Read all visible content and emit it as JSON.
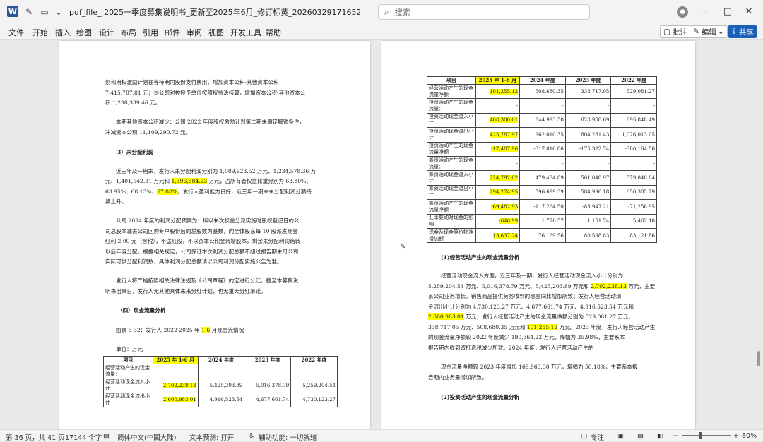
{
  "window": {
    "title": "pdf_file_    2025一季度募集说明书_更新至2025年6月_修订标黄_20260329171652_20260329171653.d...",
    "app_icon_letter": "W",
    "search_placeholder": "搜索",
    "avatar_icon": "user-icon",
    "minimize": "─",
    "maximize": "□",
    "close": "✕"
  },
  "menu": [
    "文件",
    "开始",
    "插入",
    "绘图",
    "设计",
    "布局",
    "引用",
    "邮件",
    "审阅",
    "视图",
    "开发工具",
    "帮助"
  ],
  "ribbon_right": {
    "comment": "批注",
    "edit": "编辑",
    "share": "共享"
  },
  "page1": {
    "lines": [
      {
        "parts": [
          {
            "t": "划和期权激励计划在等待期内股份支付费用，增加资本公积-其他资本公积"
          }
        ]
      },
      {
        "parts": [
          {
            "t": "7,415,787.81 元；③公司对被授予单位按照权益法核算，增加资本公积-其他资本公"
          }
        ]
      },
      {
        "parts": [
          {
            "t": "积 1,298,339.46 元。"
          }
        ]
      },
      {
        "parts": [
          {
            "t": "本期其他资本公积减少：公司 2022 年度股权激励计划第二期未满足解锁条件，"
          }
        ]
      },
      {
        "parts": [
          {
            "t": "冲减资本公积 11,109,290.72 元。"
          }
        ]
      },
      {
        "parts": [
          {
            "t": "3）未分配利润",
            "b": true
          }
        ]
      },
      {
        "parts": [
          {
            "t": "近三年及一期末，发行人未分配利润分别为 1,089,923.52 万元、1,234,578.36 万"
          }
        ]
      },
      {
        "parts": [
          {
            "t": "元、1,401,542.31 万元和 "
          },
          {
            "t": "1,396,584.23",
            "h": true
          },
          {
            "t": " 万元，占所有者权益比重分别为 63.80%、"
          }
        ]
      },
      {
        "parts": [
          {
            "t": "63.95%、68.13%、"
          },
          {
            "t": "67.88%",
            "h": true
          },
          {
            "t": "。发行人盈利能力良好，近三年一期末未分配利润分额持"
          }
        ]
      },
      {
        "parts": [
          {
            "t": "续上升。"
          }
        ]
      },
      {
        "parts": [
          {
            "t": "公司 2024 年度的利润分配预案为：拟以未次权益分派实施时股权登记日的公"
          }
        ]
      },
      {
        "parts": [
          {
            "t": "司总股本减去公司回购专户股份后的总股数为基数，向全体股东每 10 股派发现金"
          }
        ]
      },
      {
        "parts": [
          {
            "t": "红利 2.00 元（含税），不送红股，不以资本公积金转增股本，剩余未分配利润结转"
          }
        ]
      },
      {
        "parts": [
          {
            "t": "以后年度分配。根据相关规定，公司保证本次利润分配总额不超过报告期末母公司"
          }
        ]
      },
      {
        "parts": [
          {
            "t": "实际可供分配利润数，具体利润分配总额请以公司利润分配实施公告为准。"
          }
        ]
      },
      {
        "parts": [
          {
            "t": "发行人将严格按照相关法律法规及《公司章程》的定进行分红，截至本募集说"
          }
        ]
      },
      {
        "parts": [
          {
            "t": "明书出具日，发行人无其他具体未来分红计划，也无重大分红承诺。"
          }
        ]
      },
      {
        "parts": [
          {
            "t": "（四）现金流量分析",
            "b": true
          }
        ]
      },
      {
        "parts": [
          {
            "t": "图表 6-32：发行人 2022-2025 年 "
          },
          {
            "t": "1-6",
            "h": true
          },
          {
            "t": " 月现金流情况"
          }
        ]
      },
      {
        "parts": [
          {
            "t": "单位：万元",
            "u": true
          }
        ]
      }
    ],
    "table": {
      "headers": [
        "项目",
        "2025 年 1-6 月",
        "2024 年度",
        "2023 年度",
        "2022 年度"
      ],
      "rows": [
        {
          "label": "经营活动产生的现金流量：",
          "values": [
            "",
            "",
            "",
            ""
          ]
        },
        {
          "label": "经营活动现金流入小计",
          "values": [
            "2,702,238.13",
            "5,425,203.89",
            "5,016,378.79",
            "5,259,204.54"
          ]
        },
        {
          "label": "经营活动现金流出小计",
          "values": [
            "2,600,983.01",
            "4,916,523.54",
            "4,677,661.74",
            "4,730,123.27"
          ]
        }
      ]
    }
  },
  "page2": {
    "table": {
      "headers": [
        "项目",
        "2025 年 1-6 月",
        "2024 年度",
        "2023 年度",
        "2022 年度"
      ],
      "rows": [
        {
          "label": "经营活动产生的现金流量净额",
          "values": [
            "101,255.12",
            "508,680.35",
            "338,717.05",
            "529,081.27"
          ]
        },
        {
          "label": "投资活动产生的现金流量：",
          "values": [
            "-",
            "-",
            "-",
            "-"
          ]
        },
        {
          "label": "投资活动现金流入小计",
          "values": [
            "408,300.01",
            "644,993.50",
            "628,958.69",
            "695,848.49"
          ]
        },
        {
          "label": "投资活动现金流出小计",
          "values": [
            "425,787.97",
            "962,010.35",
            "804,281.43",
            "1,076,013.05"
          ]
        },
        {
          "label": "投资活动产生的现金流量净额",
          "values": [
            "-17,487.96",
            "-317,016.86",
            "-175,322.74",
            "-380,164.56"
          ]
        },
        {
          "label": "筹资活动产生的现金流量：",
          "values": [
            "-",
            "-",
            "-",
            "-"
          ]
        },
        {
          "label": "筹资活动现金流入小计",
          "values": [
            "224,792.02",
            "479,434.89",
            "501,048.97",
            "579,048.84"
          ]
        },
        {
          "label": "筹资活动现金流出小计",
          "values": [
            "294,274.95",
            "596,699.39",
            "584,996.18",
            "650,305.79"
          ]
        },
        {
          "label": "筹资活动产生的现金流量净额",
          "values": [
            "-69,482.93",
            "-117,264.50",
            "-83,947.21",
            "-71,256.95"
          ]
        },
        {
          "label": "汇率变动对现金的影响",
          "values": [
            "-646.99",
            "1,770.57",
            "1,151.74",
            "5,462.10"
          ]
        },
        {
          "label": "现金及现金等价物净增加额",
          "values": [
            "13,637.24",
            "76,169.56",
            "80,598.83",
            "83,121.86"
          ]
        }
      ]
    },
    "lines": [
      {
        "parts": [
          {
            "t": "(1)经营活动产生的现金流量分析",
            "b": true
          }
        ]
      },
      {
        "parts": [
          {
            "t": "经营活动现金流入方面，近三年及一期，发行人经营活动现金流入小计分别为"
          }
        ]
      },
      {
        "parts": [
          {
            "t": "5,259,204.54 万元、5,016,378.79 万元、5,425,203.89 万元和 "
          },
          {
            "t": "2,702,238.13",
            "h": true
          },
          {
            "t": " 万元，主要"
          }
        ]
      },
      {
        "parts": [
          {
            "t": "系公司业务增长，销售商品提供劳务收到的现金同比增加所致；发行人经营活动现"
          }
        ]
      },
      {
        "parts": [
          {
            "t": "金流出小计分别为 4,730,123.27 万元、4,677,661.74 万元、4,916,523.54 万元和"
          }
        ]
      },
      {
        "parts": [
          {
            "t": "2,600,983.01",
            "h": true
          },
          {
            "t": " 万元；发行人经营活动产生的现金流量净额分别为 529,081.27 万元、"
          }
        ]
      },
      {
        "parts": [
          {
            "t": "338,717.05 万元、508,680.35 万元和 "
          },
          {
            "t": "101,255.12",
            "h": true
          },
          {
            "t": " 万元。2023 年度，发行人经营活动产生"
          }
        ]
      },
      {
        "parts": [
          {
            "t": "的现金流量净额较 2022 年度减少 190,364.22 万元，降幅为 35.98%，主要系本"
          }
        ]
      },
      {
        "parts": [
          {
            "t": "报告期内收到留抵退税减少所致。2024 年度，发行人经营活动产生的"
          }
        ]
      },
      {
        "parts": [
          {
            "t": "现金流量净额较 2023 年度增加 169,963.30 万元，增幅为 50.18%，主要系本报"
          }
        ]
      },
      {
        "parts": [
          {
            "t": "告期内业务量增加所致。"
          }
        ]
      },
      {
        "parts": [
          {
            "t": "(2)投资活动产生的现金流量分析",
            "b": true
          }
        ]
      }
    ]
  },
  "status": {
    "page": "第 36 页，共 41 页",
    "words": "17144 个字",
    "lang": "简体中文(中国大陆)",
    "predict": "文本预测: 打开",
    "access": "辅助功能: 一切就绪",
    "zoom": "80%",
    "focus": "专注"
  }
}
